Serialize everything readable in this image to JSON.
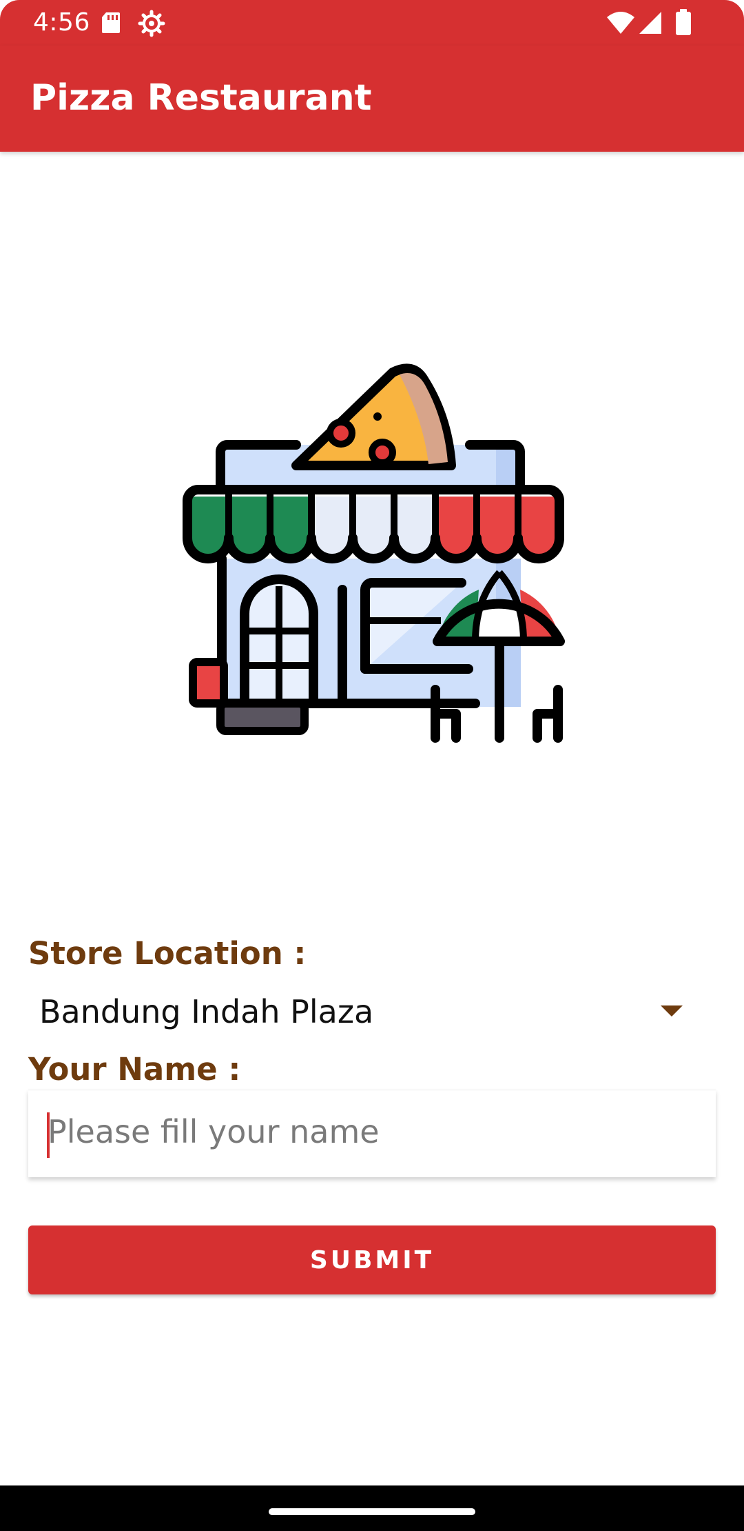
{
  "status_bar": {
    "time": "4:56",
    "icons": [
      "sd-card-icon",
      "settings-gear-icon",
      "wifi-icon",
      "cell-signal-icon",
      "battery-icon"
    ]
  },
  "app_bar": {
    "title": "Pizza Restaurant",
    "color": "#d63031"
  },
  "hero": {
    "icon": "pizza-restaurant-storefront-icon"
  },
  "form": {
    "store_location_label": "Store Location :",
    "store_location_value": "Bandung Indah Plaza",
    "name_label": "Your Name :",
    "name_value": "",
    "name_placeholder": "Please fill your name",
    "submit_label": "SUBMIT",
    "label_color": "#6e3b0e"
  }
}
